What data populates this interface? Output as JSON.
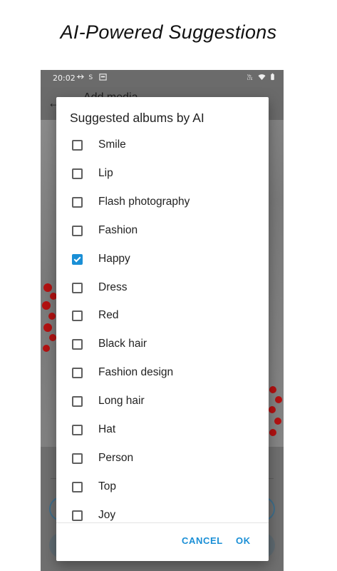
{
  "promo": {
    "title": "AI-Powered Suggestions"
  },
  "status_bar": {
    "time": "20:02"
  },
  "appbar": {
    "title": "Add media"
  },
  "dialog": {
    "title": "Suggested albums by AI",
    "options": [
      {
        "label": "Smile",
        "checked": false
      },
      {
        "label": "Lip",
        "checked": false
      },
      {
        "label": "Flash photography",
        "checked": false
      },
      {
        "label": "Fashion",
        "checked": false
      },
      {
        "label": "Happy",
        "checked": true
      },
      {
        "label": "Dress",
        "checked": false
      },
      {
        "label": "Red",
        "checked": false
      },
      {
        "label": "Black hair",
        "checked": false
      },
      {
        "label": "Fashion design",
        "checked": false
      },
      {
        "label": "Long hair",
        "checked": false
      },
      {
        "label": "Hat",
        "checked": false
      },
      {
        "label": "Person",
        "checked": false
      },
      {
        "label": "Top",
        "checked": false
      },
      {
        "label": "Joy",
        "checked": false
      }
    ],
    "cancel_label": "CANCEL",
    "ok_label": "OK"
  },
  "colors": {
    "accent": "#1a8fd6",
    "scrim": "#6b6b6b"
  },
  "icons": [
    "usb-icon",
    "sync-icon",
    "calendar-icon",
    "volte-icon",
    "wifi-icon",
    "battery-icon",
    "back-arrow-icon"
  ]
}
